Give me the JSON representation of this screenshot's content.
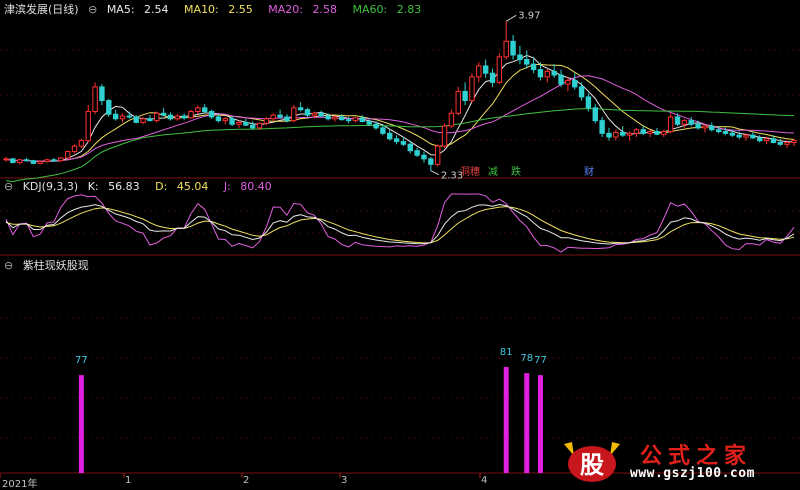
{
  "panel1": {
    "title": "津滨发展(日线)",
    "ma5": {
      "label": "MA5:",
      "value": "2.54",
      "color": "#e8e8e8"
    },
    "ma10": {
      "label": "MA10:",
      "value": "2.55",
      "color": "#f0e060"
    },
    "ma20": {
      "label": "MA20:",
      "value": "2.58",
      "color": "#e060e0"
    },
    "ma60": {
      "label": "MA60:",
      "value": "2.83",
      "color": "#40c040"
    },
    "high_label": "3.97",
    "low_label": "2.33",
    "markers": [
      {
        "text": "洞穗",
        "color": "#e04040"
      },
      {
        "text": "减",
        "color": "#40c040"
      },
      {
        "text": "跌",
        "color": "#40c040"
      },
      {
        "text": "财",
        "color": "#6080ff"
      }
    ]
  },
  "panel2": {
    "title": "KDJ(9,3,3)",
    "k": {
      "label": "K:",
      "value": "56.83",
      "color": "#e8e8e8"
    },
    "d": {
      "label": "D:",
      "value": "45.04",
      "color": "#f0e060"
    },
    "j": {
      "label": "J:",
      "value": "80.40",
      "color": "#e060e0"
    }
  },
  "panel3": {
    "title": "紫柱现妖股现"
  },
  "x_axis": {
    "labels": [
      "2021年",
      "1",
      "2",
      "3",
      "4"
    ]
  },
  "watermark": {
    "title": "公式之家",
    "site": "www.gszj100.com",
    "logo_char": "股"
  },
  "chart_data": [
    {
      "type": "candlestick",
      "title": "津滨发展(日线)",
      "series": [
        {
          "name": "MA5",
          "color": "#e8e8e8"
        },
        {
          "name": "MA10",
          "color": "#f0e060"
        },
        {
          "name": "MA20",
          "color": "#e060e0"
        },
        {
          "name": "MA60",
          "color": "#40c040"
        }
      ],
      "ylim": [
        2.25,
        4.05
      ],
      "annotations": [
        {
          "text": "3.97",
          "value": 3.97
        },
        {
          "text": "2.33",
          "value": 2.33
        }
      ],
      "candles": [
        [
          2.45,
          2.48,
          2.43,
          2.46
        ],
        [
          2.46,
          2.47,
          2.41,
          2.42
        ],
        [
          2.42,
          2.46,
          2.4,
          2.45
        ],
        [
          2.45,
          2.47,
          2.43,
          2.44
        ],
        [
          2.44,
          2.45,
          2.4,
          2.41
        ],
        [
          2.41,
          2.44,
          2.4,
          2.43
        ],
        [
          2.43,
          2.46,
          2.42,
          2.45
        ],
        [
          2.45,
          2.47,
          2.43,
          2.44
        ],
        [
          2.44,
          2.48,
          2.43,
          2.47
        ],
        [
          2.47,
          2.55,
          2.46,
          2.54
        ],
        [
          2.54,
          2.62,
          2.52,
          2.6
        ],
        [
          2.6,
          2.68,
          2.58,
          2.66
        ],
        [
          2.66,
          3.05,
          2.64,
          2.98
        ],
        [
          2.98,
          3.3,
          2.95,
          3.25
        ],
        [
          3.25,
          3.28,
          3.05,
          3.1
        ],
        [
          3.1,
          3.12,
          2.92,
          2.95
        ],
        [
          2.95,
          3.0,
          2.88,
          2.9
        ],
        [
          2.9,
          2.96,
          2.86,
          2.93
        ],
        [
          2.93,
          2.98,
          2.9,
          2.92
        ],
        [
          2.92,
          2.94,
          2.85,
          2.86
        ],
        [
          2.86,
          2.92,
          2.84,
          2.9
        ],
        [
          2.9,
          2.94,
          2.87,
          2.88
        ],
        [
          2.88,
          2.98,
          2.86,
          2.96
        ],
        [
          2.96,
          3.02,
          2.93,
          2.94
        ],
        [
          2.94,
          2.97,
          2.88,
          2.9
        ],
        [
          2.9,
          2.95,
          2.88,
          2.93
        ],
        [
          2.93,
          2.96,
          2.89,
          2.91
        ],
        [
          2.91,
          3.0,
          2.9,
          2.98
        ],
        [
          2.98,
          3.05,
          2.95,
          3.02
        ],
        [
          3.02,
          3.06,
          2.96,
          2.98
        ],
        [
          2.98,
          3.0,
          2.9,
          2.92
        ],
        [
          2.92,
          2.95,
          2.86,
          2.88
        ],
        [
          2.88,
          2.92,
          2.84,
          2.9
        ],
        [
          2.9,
          2.93,
          2.82,
          2.84
        ],
        [
          2.84,
          2.88,
          2.8,
          2.86
        ],
        [
          2.86,
          2.9,
          2.82,
          2.83
        ],
        [
          2.83,
          2.87,
          2.78,
          2.8
        ],
        [
          2.8,
          2.86,
          2.78,
          2.85
        ],
        [
          2.85,
          2.92,
          2.83,
          2.9
        ],
        [
          2.9,
          2.96,
          2.87,
          2.94
        ],
        [
          2.94,
          3.0,
          2.9,
          2.92
        ],
        [
          2.92,
          2.95,
          2.86,
          2.88
        ],
        [
          2.88,
          3.05,
          2.86,
          3.02
        ],
        [
          3.02,
          3.08,
          2.98,
          3.0
        ],
        [
          3.0,
          3.02,
          2.92,
          2.94
        ],
        [
          2.94,
          2.98,
          2.9,
          2.96
        ],
        [
          2.96,
          2.99,
          2.92,
          2.93
        ],
        [
          2.93,
          2.96,
          2.88,
          2.9
        ],
        [
          2.9,
          2.94,
          2.87,
          2.92
        ],
        [
          2.92,
          2.95,
          2.88,
          2.89
        ],
        [
          2.89,
          2.92,
          2.85,
          2.88
        ],
        [
          2.88,
          2.92,
          2.86,
          2.91
        ],
        [
          2.91,
          2.94,
          2.86,
          2.87
        ],
        [
          2.87,
          2.9,
          2.82,
          2.84
        ],
        [
          2.84,
          2.87,
          2.78,
          2.8
        ],
        [
          2.8,
          2.83,
          2.72,
          2.74
        ],
        [
          2.74,
          2.78,
          2.66,
          2.68
        ],
        [
          2.68,
          2.72,
          2.62,
          2.65
        ],
        [
          2.65,
          2.7,
          2.6,
          2.62
        ],
        [
          2.62,
          2.66,
          2.52,
          2.55
        ],
        [
          2.55,
          2.58,
          2.48,
          2.5
        ],
        [
          2.5,
          2.54,
          2.42,
          2.46
        ],
        [
          2.46,
          2.48,
          2.33,
          2.4
        ],
        [
          2.4,
          2.62,
          2.38,
          2.6
        ],
        [
          2.6,
          2.85,
          2.58,
          2.82
        ],
        [
          2.82,
          3.0,
          2.8,
          2.96
        ],
        [
          2.96,
          3.25,
          2.94,
          3.2
        ],
        [
          3.2,
          3.3,
          3.05,
          3.1
        ],
        [
          3.1,
          3.4,
          3.08,
          3.36
        ],
        [
          3.36,
          3.52,
          3.3,
          3.48
        ],
        [
          3.48,
          3.55,
          3.35,
          3.4
        ],
        [
          3.4,
          3.45,
          3.25,
          3.3
        ],
        [
          3.3,
          3.62,
          3.28,
          3.58
        ],
        [
          3.58,
          3.97,
          3.55,
          3.75
        ],
        [
          3.75,
          3.82,
          3.55,
          3.6
        ],
        [
          3.6,
          3.7,
          3.5,
          3.55
        ],
        [
          3.55,
          3.65,
          3.45,
          3.5
        ],
        [
          3.5,
          3.58,
          3.4,
          3.44
        ],
        [
          3.44,
          3.52,
          3.32,
          3.36
        ],
        [
          3.36,
          3.45,
          3.3,
          3.42
        ],
        [
          3.42,
          3.5,
          3.35,
          3.38
        ],
        [
          3.38,
          3.44,
          3.25,
          3.28
        ],
        [
          3.28,
          3.36,
          3.2,
          3.32
        ],
        [
          3.32,
          3.4,
          3.22,
          3.25
        ],
        [
          3.25,
          3.3,
          3.1,
          3.14
        ],
        [
          3.14,
          3.18,
          2.98,
          3.02
        ],
        [
          3.02,
          3.06,
          2.85,
          2.88
        ],
        [
          2.88,
          2.92,
          2.7,
          2.74
        ],
        [
          2.74,
          2.8,
          2.66,
          2.7
        ],
        [
          2.7,
          2.78,
          2.66,
          2.75
        ],
        [
          2.75,
          2.82,
          2.7,
          2.72
        ],
        [
          2.72,
          2.76,
          2.66,
          2.74
        ],
        [
          2.74,
          2.8,
          2.7,
          2.78
        ],
        [
          2.78,
          2.82,
          2.72,
          2.74
        ],
        [
          2.74,
          2.78,
          2.7,
          2.76
        ],
        [
          2.76,
          2.8,
          2.72,
          2.73
        ],
        [
          2.73,
          2.78,
          2.7,
          2.76
        ],
        [
          2.76,
          2.96,
          2.74,
          2.92
        ],
        [
          2.92,
          2.96,
          2.82,
          2.84
        ],
        [
          2.84,
          2.9,
          2.8,
          2.88
        ],
        [
          2.88,
          2.92,
          2.82,
          2.84
        ],
        [
          2.84,
          2.88,
          2.78,
          2.8
        ],
        [
          2.8,
          2.84,
          2.75,
          2.82
        ],
        [
          2.82,
          2.86,
          2.76,
          2.78
        ],
        [
          2.78,
          2.82,
          2.74,
          2.76
        ],
        [
          2.76,
          2.8,
          2.72,
          2.74
        ],
        [
          2.74,
          2.78,
          2.7,
          2.72
        ],
        [
          2.72,
          2.76,
          2.68,
          2.7
        ],
        [
          2.7,
          2.74,
          2.66,
          2.72
        ],
        [
          2.72,
          2.75,
          2.68,
          2.69
        ],
        [
          2.69,
          2.72,
          2.64,
          2.66
        ],
        [
          2.66,
          2.7,
          2.62,
          2.68
        ],
        [
          2.68,
          2.72,
          2.63,
          2.64
        ],
        [
          2.64,
          2.68,
          2.6,
          2.62
        ],
        [
          2.62,
          2.66,
          2.58,
          2.64
        ],
        [
          2.64,
          2.68,
          2.6,
          2.66
        ]
      ]
    },
    {
      "type": "line",
      "title": "KDJ(9,3,3)",
      "series": [
        {
          "name": "K",
          "color": "#e8e8e8"
        },
        {
          "name": "D",
          "color": "#f0e060"
        },
        {
          "name": "J",
          "color": "#e060e0"
        }
      ],
      "ylim": [
        0,
        100
      ]
    },
    {
      "type": "bar",
      "title": "紫柱现妖股现",
      "bar_color": "#e020e0",
      "bars": [
        {
          "index": 11,
          "value": 77,
          "label": "77"
        },
        {
          "index": 73,
          "value": 81,
          "label": "81"
        },
        {
          "index": 76,
          "value": 78,
          "label": "78"
        },
        {
          "index": 78,
          "value": 77,
          "label": "77"
        }
      ],
      "ylim": [
        0,
        100
      ]
    }
  ]
}
